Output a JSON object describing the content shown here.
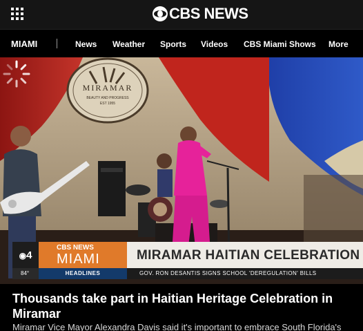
{
  "header": {
    "logo_text": "CBS NEWS",
    "menu_icon": "grid-menu-icon"
  },
  "nav": {
    "section": "MIAMI",
    "items": [
      "News",
      "Weather",
      "Sports",
      "Videos",
      "CBS Miami Shows",
      "More"
    ]
  },
  "video": {
    "backdrop_sign": [
      "MIRAMAR",
      "BEAUTY AND PROGRESS",
      "EST 1955"
    ],
    "status_icon": "loading-spinner-icon",
    "lower_third": {
      "channel": "4",
      "brand_top": "CBS NEWS",
      "brand_bottom": "MIAMI",
      "headline": "MIRAMAR HAITIAN CELEBRATION",
      "temperature": "84°",
      "tag": "HEADLINES",
      "ticker": "GOV. RON DESANTIS SIGNS SCHOOL 'DEREGULATION' BILLS"
    }
  },
  "article": {
    "title": "Thousands take part in Haitian Heritage Celebration in Miramar",
    "summary": "Miramar Vice Mayor Alexandra Davis said it's important to embrace South Florida's"
  },
  "colors": {
    "brand_orange": "#e07a2a",
    "tag_blue": "#133a6a"
  }
}
